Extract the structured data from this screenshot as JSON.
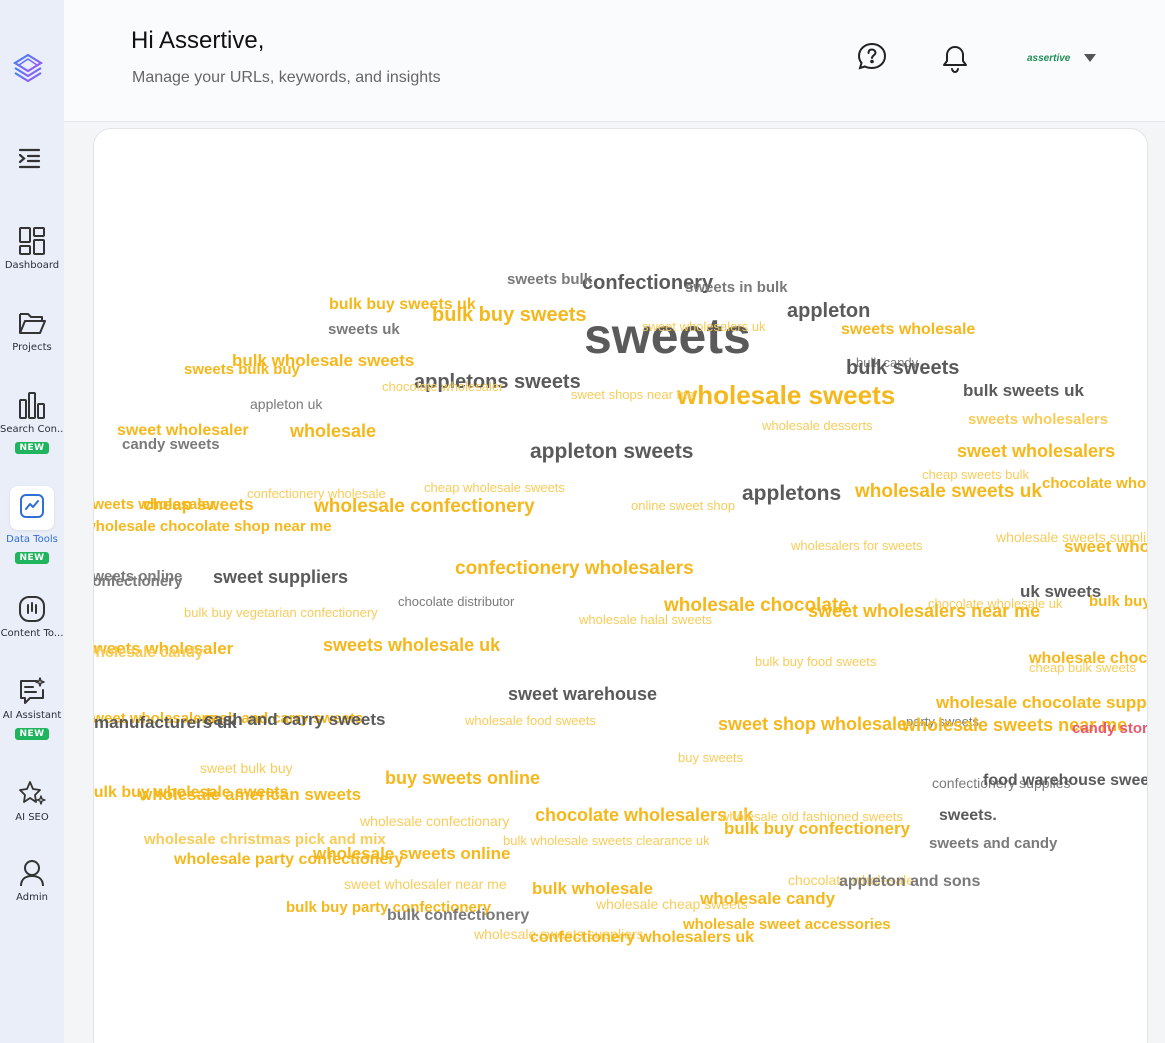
{
  "header": {
    "greeting": "Hi Assertive,",
    "subtitle": "Manage your URLs, keywords, and insights",
    "account_name": "assertive"
  },
  "sidebar": {
    "items": [
      {
        "label": "Dashboard",
        "icon": "dashboard-icon"
      },
      {
        "label": "Projects",
        "icon": "folder-icon"
      },
      {
        "label": "Search Con...",
        "icon": "bar-chart-icon",
        "badge": "NEW"
      },
      {
        "label": "Data Tools",
        "icon": "line-chart-icon",
        "badge": "NEW",
        "active": true
      },
      {
        "label": "Content To...",
        "icon": "content-icon"
      },
      {
        "label": "AI Assistant",
        "icon": "chat-sparkle-icon",
        "badge": "NEW"
      },
      {
        "label": "AI SEO",
        "icon": "star-sparkle-icon"
      },
      {
        "label": "Admin",
        "icon": "user-icon"
      }
    ]
  },
  "colors": {
    "gold": "#f5b81c",
    "gold_light": "#f7cc5a",
    "gray_dark": "#5a5a5a",
    "gray": "#7a7a7a",
    "red": "#e85a6e",
    "accent": "#2f6fd6",
    "badge": "#1fb55e"
  },
  "wordcloud": [
    {
      "text": "sweets",
      "c": "gray_dark",
      "s": 50
    },
    {
      "text": "wholesale sweets",
      "c": "gold",
      "s": 26
    },
    {
      "text": "confectionery",
      "c": "gray_dark",
      "s": 20
    },
    {
      "text": "sweets bulk",
      "c": "gray",
      "s": 15
    },
    {
      "text": "sweets in bulk",
      "c": "gray",
      "s": 15
    },
    {
      "text": "appleton",
      "c": "gray_dark",
      "s": 20
    },
    {
      "text": "bulk buy sweets uk",
      "c": "gold",
      "s": 16
    },
    {
      "text": "bulk buy sweets",
      "c": "gold",
      "s": 20
    },
    {
      "text": "sweets uk",
      "c": "gray",
      "s": 15
    },
    {
      "text": "sweet wholesalers uk",
      "c": "gold_light",
      "s": 13
    },
    {
      "text": "sweets wholesale",
      "c": "gold",
      "s": 16
    },
    {
      "text": "bulk wholesale sweets",
      "c": "gold",
      "s": 17
    },
    {
      "text": "sweets bulk buy",
      "c": "gold",
      "s": 15
    },
    {
      "text": "bulk candy",
      "c": "gray",
      "s": 13
    },
    {
      "text": "bulk sweets",
      "c": "gray_dark",
      "s": 20
    },
    {
      "text": "appletons sweets",
      "c": "gray_dark",
      "s": 20
    },
    {
      "text": "chocolate wholesaler",
      "c": "gold_light",
      "s": 13
    },
    {
      "text": "sweet shops near me",
      "c": "gold_light",
      "s": 13
    },
    {
      "text": "bulk sweets uk",
      "c": "gray_dark",
      "s": 17
    },
    {
      "text": "appleton uk",
      "c": "gray",
      "s": 14
    },
    {
      "text": "sweets wholesalers",
      "c": "gold_light",
      "s": 15
    },
    {
      "text": "sweet wholesaler",
      "c": "gold",
      "s": 16
    },
    {
      "text": "wholesale",
      "c": "gold",
      "s": 18
    },
    {
      "text": "wholesale desserts",
      "c": "gold_light",
      "s": 13
    },
    {
      "text": "candy sweets",
      "c": "gray",
      "s": 15
    },
    {
      "text": "appleton sweets",
      "c": "gray_dark",
      "s": 21
    },
    {
      "text": "sweet wholesalers",
      "c": "gold",
      "s": 18
    },
    {
      "text": "cheap sweets bulk",
      "c": "gold_light",
      "s": 13
    },
    {
      "text": "chocolate wholesale",
      "c": "gold",
      "s": 15
    },
    {
      "text": "appletons",
      "c": "gray_dark",
      "s": 21
    },
    {
      "text": "wholesale sweets uk",
      "c": "gold",
      "s": 19
    },
    {
      "text": "cheap wholesale sweets",
      "c": "gold_light",
      "s": 13
    },
    {
      "text": "confectionery wholesale",
      "c": "gold_light",
      "s": 13
    },
    {
      "text": "sweets wholesaler",
      "c": "gold",
      "s": 15
    },
    {
      "text": "cheap sweets",
      "c": "gold",
      "s": 17
    },
    {
      "text": "wholesale confectionery",
      "c": "gold",
      "s": 19
    },
    {
      "text": "online sweet shop",
      "c": "gold_light",
      "s": 13
    },
    {
      "text": "wholesale chocolate shop near me",
      "c": "gold",
      "s": 15
    },
    {
      "text": "wholesalers for sweets",
      "c": "gold_light",
      "s": 13
    },
    {
      "text": "wholesale sweets suppliers",
      "c": "gold_light",
      "s": 14
    },
    {
      "text": "sweet wholesale",
      "c": "gold",
      "s": 17
    },
    {
      "text": "sweets online",
      "c": "gray",
      "s": 15
    },
    {
      "text": "confectionery",
      "c": "gray",
      "s": 15
    },
    {
      "text": "sweet suppliers",
      "c": "gray_dark",
      "s": 18
    },
    {
      "text": "confectionery wholesalers",
      "c": "gold",
      "s": 19
    },
    {
      "text": "uk sweets",
      "c": "gray_dark",
      "s": 17
    },
    {
      "text": "chocolate distributor",
      "c": "gray",
      "s": 13
    },
    {
      "text": "bulk buy vegetarian confectionery",
      "c": "gold_light",
      "s": 13
    },
    {
      "text": "wholesale chocolate",
      "c": "gold",
      "s": 19
    },
    {
      "text": "chocolate wholesale uk",
      "c": "gold_light",
      "s": 13
    },
    {
      "text": "bulk buy sweets",
      "c": "gold",
      "s": 15
    },
    {
      "text": "wholesale halal sweets",
      "c": "gold_light",
      "s": 13
    },
    {
      "text": "sweet wholesalers near me",
      "c": "gold",
      "s": 18
    },
    {
      "text": "sweets wholesaler",
      "c": "gold",
      "s": 17
    },
    {
      "text": "wholesale candy",
      "c": "gold_light",
      "s": 15
    },
    {
      "text": "sweets wholesale uk",
      "c": "gold",
      "s": 18
    },
    {
      "text": "bulk buy food sweets",
      "c": "gold_light",
      "s": 13
    },
    {
      "text": "wholesale chocolates",
      "c": "gold",
      "s": 16
    },
    {
      "text": "cheap bulk sweets",
      "c": "gold_light",
      "s": 13
    },
    {
      "text": "sweet warehouse",
      "c": "gray_dark",
      "s": 18
    },
    {
      "text": "wholesale chocolate suppliers",
      "c": "gold",
      "s": 17
    },
    {
      "text": "sweet wholesalers",
      "c": "gold",
      "s": 15
    },
    {
      "text": "cash and carry sweets",
      "c": "gold",
      "s": 15
    },
    {
      "text": "manufacturers uk",
      "c": "gray_dark",
      "s": 17
    },
    {
      "text": "cash and carry sweets",
      "c": "gray_dark",
      "s": 17
    },
    {
      "text": "wholesale food sweets",
      "c": "gold_light",
      "s": 13
    },
    {
      "text": "sweet shop wholesale",
      "c": "gold",
      "s": 18
    },
    {
      "text": "party sweets",
      "c": "gray",
      "s": 13
    },
    {
      "text": "wholesale sweets near me",
      "c": "gold",
      "s": 18
    },
    {
      "text": "candy store",
      "c": "red",
      "s": 15
    },
    {
      "text": "sweet bulk buy",
      "c": "gold_light",
      "s": 14
    },
    {
      "text": "buy sweets",
      "c": "gold_light",
      "s": 13
    },
    {
      "text": "buy sweets online",
      "c": "gold",
      "s": 18
    },
    {
      "text": "confectionery supplies",
      "c": "gray",
      "s": 14
    },
    {
      "text": "food warehouse sweets",
      "c": "gray_dark",
      "s": 16
    },
    {
      "text": "bulk buy wholesale sweets",
      "c": "gold",
      "s": 16
    },
    {
      "text": "wholesale american sweets",
      "c": "gold",
      "s": 17
    },
    {
      "text": "wholesale confectionary",
      "c": "gold_light",
      "s": 14
    },
    {
      "text": "chocolate wholesalers uk",
      "c": "gold",
      "s": 18
    },
    {
      "text": "wholesale old fashioned sweets",
      "c": "gold_light",
      "s": 13
    },
    {
      "text": "sweets.",
      "c": "gray_dark",
      "s": 16
    },
    {
      "text": "bulk buy confectionery",
      "c": "gold",
      "s": 17
    },
    {
      "text": "wholesale christmas pick and mix",
      "c": "gold_light",
      "s": 15
    },
    {
      "text": "bulk wholesale sweets clearance uk",
      "c": "gold_light",
      "s": 13
    },
    {
      "text": "sweets and candy",
      "c": "gray",
      "s": 15
    },
    {
      "text": "wholesale party confectionery",
      "c": "gold",
      "s": 16
    },
    {
      "text": "wholesale sweets online",
      "c": "gold",
      "s": 17
    },
    {
      "text": "sweet wholesaler near me",
      "c": "gold_light",
      "s": 14
    },
    {
      "text": "chocolate wholesale",
      "c": "gold_light",
      "s": 14
    },
    {
      "text": "bulk wholesale",
      "c": "gold",
      "s": 17
    },
    {
      "text": "appleton and sons",
      "c": "gray",
      "s": 16
    },
    {
      "text": "wholesale cheap sweets",
      "c": "gold_light",
      "s": 14
    },
    {
      "text": "wholesale candy",
      "c": "gold",
      "s": 17
    },
    {
      "text": "bulk buy party confectionery",
      "c": "gold",
      "s": 15
    },
    {
      "text": "bulk confectionery",
      "c": "gray",
      "s": 16
    },
    {
      "text": "wholesale sweet accessories",
      "c": "gold",
      "s": 15
    },
    {
      "text": "wholesale sweets suppliers",
      "c": "gold_light",
      "s": 14
    },
    {
      "text": "confectionery wholesalers uk",
      "c": "gold",
      "s": 16
    }
  ]
}
